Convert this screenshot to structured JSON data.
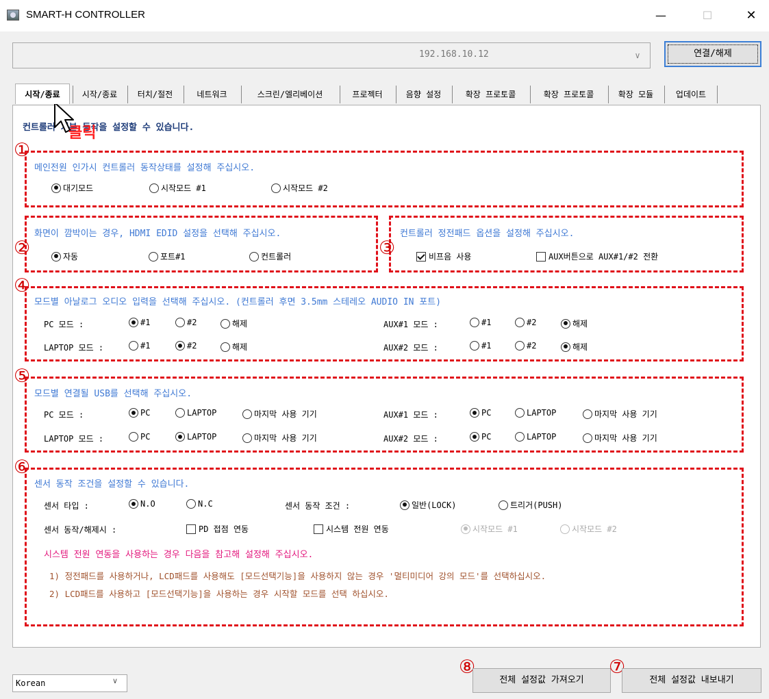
{
  "window": {
    "title": "SMART-H CONTROLLER",
    "min": "—",
    "max": "☐",
    "close": "✕"
  },
  "topbar": {
    "ip": "192.168.10.12",
    "combo_arrow": "∨",
    "connect_label": "연결/해제"
  },
  "tabs": [
    {
      "label": "시작/종료"
    },
    {
      "label": "시작/종료"
    },
    {
      "label": "터치/절전"
    },
    {
      "label": "네트워크"
    },
    {
      "label": "스크린/엘리베이션"
    },
    {
      "label": "프로젝터"
    },
    {
      "label": "음향 설정"
    },
    {
      "label": "확장 프로토콜"
    },
    {
      "label": "확장 프로토콜"
    },
    {
      "label": "확장 모듈"
    },
    {
      "label": "업데이트"
    }
  ],
  "subtitle": "컨트롤러 기본 동작을 설정할 수 있습니다.",
  "annotation": {
    "click": "클릭"
  },
  "numbers": [
    "①",
    "②",
    "③",
    "④",
    "⑤",
    "⑥",
    "⑦",
    "⑧"
  ],
  "g1": {
    "title": "메인전원 인가시 컨트롤러 동작상태를 설정해 주십시오.",
    "options": [
      {
        "label": "대기모드",
        "selected": true
      },
      {
        "label": "시작모드 #1",
        "selected": false
      },
      {
        "label": "시작모드 #2",
        "selected": false
      }
    ]
  },
  "g2": {
    "title": "화면이 깜박이는 경우, HDMI EDID 설정을 선택해 주십시오.",
    "options": [
      {
        "label": "자동",
        "selected": true
      },
      {
        "label": "포트#1",
        "selected": false
      },
      {
        "label": "컨트롤러",
        "selected": false
      }
    ]
  },
  "g3": {
    "title": "컨트롤러 정전패드 옵션을 설정해 주십시오.",
    "checks": [
      {
        "label": "비프음 사용",
        "checked": true
      },
      {
        "label": "AUX버튼으로 AUX#1/#2 전환",
        "checked": false
      }
    ]
  },
  "g4": {
    "title": "모드별 아날로그 오디오 입력을 선택해 주십시오. (컨트롤러 후면 3.5mm 스테레오 AUDIO IN 포트)",
    "rows": [
      {
        "label": "PC 모드 :",
        "options": [
          "#1",
          "#2",
          "해제"
        ],
        "selected": 0
      },
      {
        "label": "LAPTOP 모드 :",
        "options": [
          "#1",
          "#2",
          "해제"
        ],
        "selected": 1
      },
      {
        "label": "AUX#1 모드 :",
        "options": [
          "#1",
          "#2",
          "해제"
        ],
        "selected": 2
      },
      {
        "label": "AUX#2 모드 :",
        "options": [
          "#1",
          "#2",
          "해제"
        ],
        "selected": 2
      }
    ]
  },
  "g5": {
    "title": "모드별 연결될 USB를 선택해 주십시오.",
    "rows": [
      {
        "label": "PC 모드 :",
        "options": [
          "PC",
          "LAPTOP",
          "마지막 사용 기기"
        ],
        "selected": 0
      },
      {
        "label": "LAPTOP 모드 :",
        "options": [
          "PC",
          "LAPTOP",
          "마지막 사용 기기"
        ],
        "selected": 1
      },
      {
        "label": "AUX#1 모드 :",
        "options": [
          "PC",
          "LAPTOP",
          "마지막 사용 기기"
        ],
        "selected": 0
      },
      {
        "label": "AUX#2 모드 :",
        "options": [
          "PC",
          "LAPTOP",
          "마지막 사용 기기"
        ],
        "selected": 0
      }
    ]
  },
  "g6": {
    "title": "센서 동작 조건을 설정할 수 있습니다.",
    "sensor_type_label": "센서 타입 :",
    "sensor_type": [
      {
        "label": "N.O",
        "selected": true
      },
      {
        "label": "N.C",
        "selected": false
      }
    ],
    "sensor_cond_label": "센서 동작 조건 :",
    "sensor_cond": [
      {
        "label": "일반(LOCK)",
        "selected": true
      },
      {
        "label": "트리거(PUSH)",
        "selected": false
      }
    ],
    "release_label": "센서 동작/해제시 :",
    "release_checks": [
      {
        "label": "PD 접점 연동",
        "checked": false
      },
      {
        "label": "시스템 전원 연동",
        "checked": false
      }
    ],
    "release_modes": [
      {
        "label": "시작모드 #1",
        "selected": true
      },
      {
        "label": "시작모드 #2",
        "selected": false
      }
    ],
    "warning": "시스템 전원 연동을 사용하는 경우 다음을 참고해 설정해 주십시오.",
    "note1": "1) 정전패드를 사용하거나, LCD패드를 사용해도 [모드선택기능]을 사용하지 않는 경우 '멀티미디어 강의 모드'를 선택하십시오.",
    "note2": "2) LCD패드를 사용하고 [모드선택기능]을 사용하는 경우 시작할 모드를 선택 하십시오."
  },
  "bottom": {
    "language": "Korean",
    "import_label": "전체 설정값 가져오기",
    "export_label": "전체 설정값 내보내기"
  },
  "colors": {
    "dash": "#e0101a",
    "title_blue": "#3f79d4",
    "warning": "#e3187d",
    "note": "#a0522d",
    "accent": "#3c7fd6"
  }
}
